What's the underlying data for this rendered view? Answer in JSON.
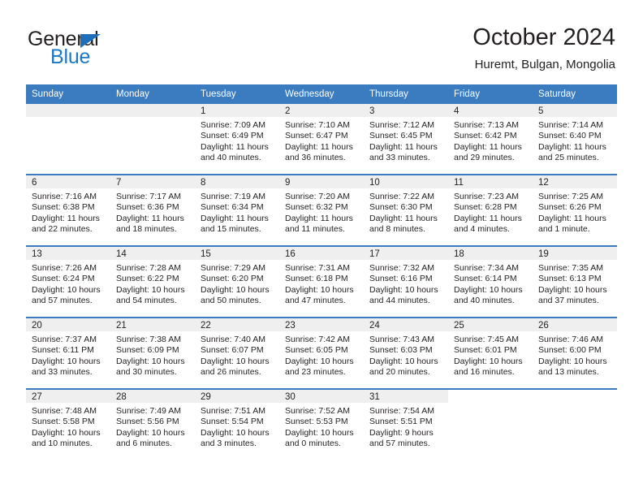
{
  "brand": {
    "name_top": "General",
    "name_bottom": "Blue",
    "triangle_color": "#1e6fb8",
    "blue_color": "#1c78c0"
  },
  "header": {
    "month_title": "October 2024",
    "location": "Huremt, Bulgan, Mongolia"
  },
  "theme": {
    "header_blue": "#3b7cc0",
    "daynum_band": "#efefef",
    "text": "#231f20"
  },
  "weekday_headers": [
    "Sunday",
    "Monday",
    "Tuesday",
    "Wednesday",
    "Thursday",
    "Friday",
    "Saturday"
  ],
  "weeks": [
    [
      {
        "day": "",
        "sunrise": "",
        "sunset": "",
        "daylight_line1": "",
        "daylight_line2": "",
        "empty": true
      },
      {
        "day": "",
        "sunrise": "",
        "sunset": "",
        "daylight_line1": "",
        "daylight_line2": "",
        "empty": true
      },
      {
        "day": "1",
        "sunrise": "Sunrise: 7:09 AM",
        "sunset": "Sunset: 6:49 PM",
        "daylight_line1": "Daylight: 11 hours",
        "daylight_line2": "and 40 minutes."
      },
      {
        "day": "2",
        "sunrise": "Sunrise: 7:10 AM",
        "sunset": "Sunset: 6:47 PM",
        "daylight_line1": "Daylight: 11 hours",
        "daylight_line2": "and 36 minutes."
      },
      {
        "day": "3",
        "sunrise": "Sunrise: 7:12 AM",
        "sunset": "Sunset: 6:45 PM",
        "daylight_line1": "Daylight: 11 hours",
        "daylight_line2": "and 33 minutes."
      },
      {
        "day": "4",
        "sunrise": "Sunrise: 7:13 AM",
        "sunset": "Sunset: 6:42 PM",
        "daylight_line1": "Daylight: 11 hours",
        "daylight_line2": "and 29 minutes."
      },
      {
        "day": "5",
        "sunrise": "Sunrise: 7:14 AM",
        "sunset": "Sunset: 6:40 PM",
        "daylight_line1": "Daylight: 11 hours",
        "daylight_line2": "and 25 minutes."
      }
    ],
    [
      {
        "day": "6",
        "sunrise": "Sunrise: 7:16 AM",
        "sunset": "Sunset: 6:38 PM",
        "daylight_line1": "Daylight: 11 hours",
        "daylight_line2": "and 22 minutes."
      },
      {
        "day": "7",
        "sunrise": "Sunrise: 7:17 AM",
        "sunset": "Sunset: 6:36 PM",
        "daylight_line1": "Daylight: 11 hours",
        "daylight_line2": "and 18 minutes."
      },
      {
        "day": "8",
        "sunrise": "Sunrise: 7:19 AM",
        "sunset": "Sunset: 6:34 PM",
        "daylight_line1": "Daylight: 11 hours",
        "daylight_line2": "and 15 minutes."
      },
      {
        "day": "9",
        "sunrise": "Sunrise: 7:20 AM",
        "sunset": "Sunset: 6:32 PM",
        "daylight_line1": "Daylight: 11 hours",
        "daylight_line2": "and 11 minutes."
      },
      {
        "day": "10",
        "sunrise": "Sunrise: 7:22 AM",
        "sunset": "Sunset: 6:30 PM",
        "daylight_line1": "Daylight: 11 hours",
        "daylight_line2": "and 8 minutes."
      },
      {
        "day": "11",
        "sunrise": "Sunrise: 7:23 AM",
        "sunset": "Sunset: 6:28 PM",
        "daylight_line1": "Daylight: 11 hours",
        "daylight_line2": "and 4 minutes."
      },
      {
        "day": "12",
        "sunrise": "Sunrise: 7:25 AM",
        "sunset": "Sunset: 6:26 PM",
        "daylight_line1": "Daylight: 11 hours",
        "daylight_line2": "and 1 minute."
      }
    ],
    [
      {
        "day": "13",
        "sunrise": "Sunrise: 7:26 AM",
        "sunset": "Sunset: 6:24 PM",
        "daylight_line1": "Daylight: 10 hours",
        "daylight_line2": "and 57 minutes."
      },
      {
        "day": "14",
        "sunrise": "Sunrise: 7:28 AM",
        "sunset": "Sunset: 6:22 PM",
        "daylight_line1": "Daylight: 10 hours",
        "daylight_line2": "and 54 minutes."
      },
      {
        "day": "15",
        "sunrise": "Sunrise: 7:29 AM",
        "sunset": "Sunset: 6:20 PM",
        "daylight_line1": "Daylight: 10 hours",
        "daylight_line2": "and 50 minutes."
      },
      {
        "day": "16",
        "sunrise": "Sunrise: 7:31 AM",
        "sunset": "Sunset: 6:18 PM",
        "daylight_line1": "Daylight: 10 hours",
        "daylight_line2": "and 47 minutes."
      },
      {
        "day": "17",
        "sunrise": "Sunrise: 7:32 AM",
        "sunset": "Sunset: 6:16 PM",
        "daylight_line1": "Daylight: 10 hours",
        "daylight_line2": "and 44 minutes."
      },
      {
        "day": "18",
        "sunrise": "Sunrise: 7:34 AM",
        "sunset": "Sunset: 6:14 PM",
        "daylight_line1": "Daylight: 10 hours",
        "daylight_line2": "and 40 minutes."
      },
      {
        "day": "19",
        "sunrise": "Sunrise: 7:35 AM",
        "sunset": "Sunset: 6:13 PM",
        "daylight_line1": "Daylight: 10 hours",
        "daylight_line2": "and 37 minutes."
      }
    ],
    [
      {
        "day": "20",
        "sunrise": "Sunrise: 7:37 AM",
        "sunset": "Sunset: 6:11 PM",
        "daylight_line1": "Daylight: 10 hours",
        "daylight_line2": "and 33 minutes."
      },
      {
        "day": "21",
        "sunrise": "Sunrise: 7:38 AM",
        "sunset": "Sunset: 6:09 PM",
        "daylight_line1": "Daylight: 10 hours",
        "daylight_line2": "and 30 minutes."
      },
      {
        "day": "22",
        "sunrise": "Sunrise: 7:40 AM",
        "sunset": "Sunset: 6:07 PM",
        "daylight_line1": "Daylight: 10 hours",
        "daylight_line2": "and 26 minutes."
      },
      {
        "day": "23",
        "sunrise": "Sunrise: 7:42 AM",
        "sunset": "Sunset: 6:05 PM",
        "daylight_line1": "Daylight: 10 hours",
        "daylight_line2": "and 23 minutes."
      },
      {
        "day": "24",
        "sunrise": "Sunrise: 7:43 AM",
        "sunset": "Sunset: 6:03 PM",
        "daylight_line1": "Daylight: 10 hours",
        "daylight_line2": "and 20 minutes."
      },
      {
        "day": "25",
        "sunrise": "Sunrise: 7:45 AM",
        "sunset": "Sunset: 6:01 PM",
        "daylight_line1": "Daylight: 10 hours",
        "daylight_line2": "and 16 minutes."
      },
      {
        "day": "26",
        "sunrise": "Sunrise: 7:46 AM",
        "sunset": "Sunset: 6:00 PM",
        "daylight_line1": "Daylight: 10 hours",
        "daylight_line2": "and 13 minutes."
      }
    ],
    [
      {
        "day": "27",
        "sunrise": "Sunrise: 7:48 AM",
        "sunset": "Sunset: 5:58 PM",
        "daylight_line1": "Daylight: 10 hours",
        "daylight_line2": "and 10 minutes."
      },
      {
        "day": "28",
        "sunrise": "Sunrise: 7:49 AM",
        "sunset": "Sunset: 5:56 PM",
        "daylight_line1": "Daylight: 10 hours",
        "daylight_line2": "and 6 minutes."
      },
      {
        "day": "29",
        "sunrise": "Sunrise: 7:51 AM",
        "sunset": "Sunset: 5:54 PM",
        "daylight_line1": "Daylight: 10 hours",
        "daylight_line2": "and 3 minutes."
      },
      {
        "day": "30",
        "sunrise": "Sunrise: 7:52 AM",
        "sunset": "Sunset: 5:53 PM",
        "daylight_line1": "Daylight: 10 hours",
        "daylight_line2": "and 0 minutes."
      },
      {
        "day": "31",
        "sunrise": "Sunrise: 7:54 AM",
        "sunset": "Sunset: 5:51 PM",
        "daylight_line1": "Daylight: 9 hours",
        "daylight_line2": "and 57 minutes."
      },
      {
        "day": "",
        "sunrise": "",
        "sunset": "",
        "daylight_line1": "",
        "daylight_line2": "",
        "empty": true
      },
      {
        "day": "",
        "sunrise": "",
        "sunset": "",
        "daylight_line1": "",
        "daylight_line2": "",
        "empty": true
      }
    ]
  ]
}
